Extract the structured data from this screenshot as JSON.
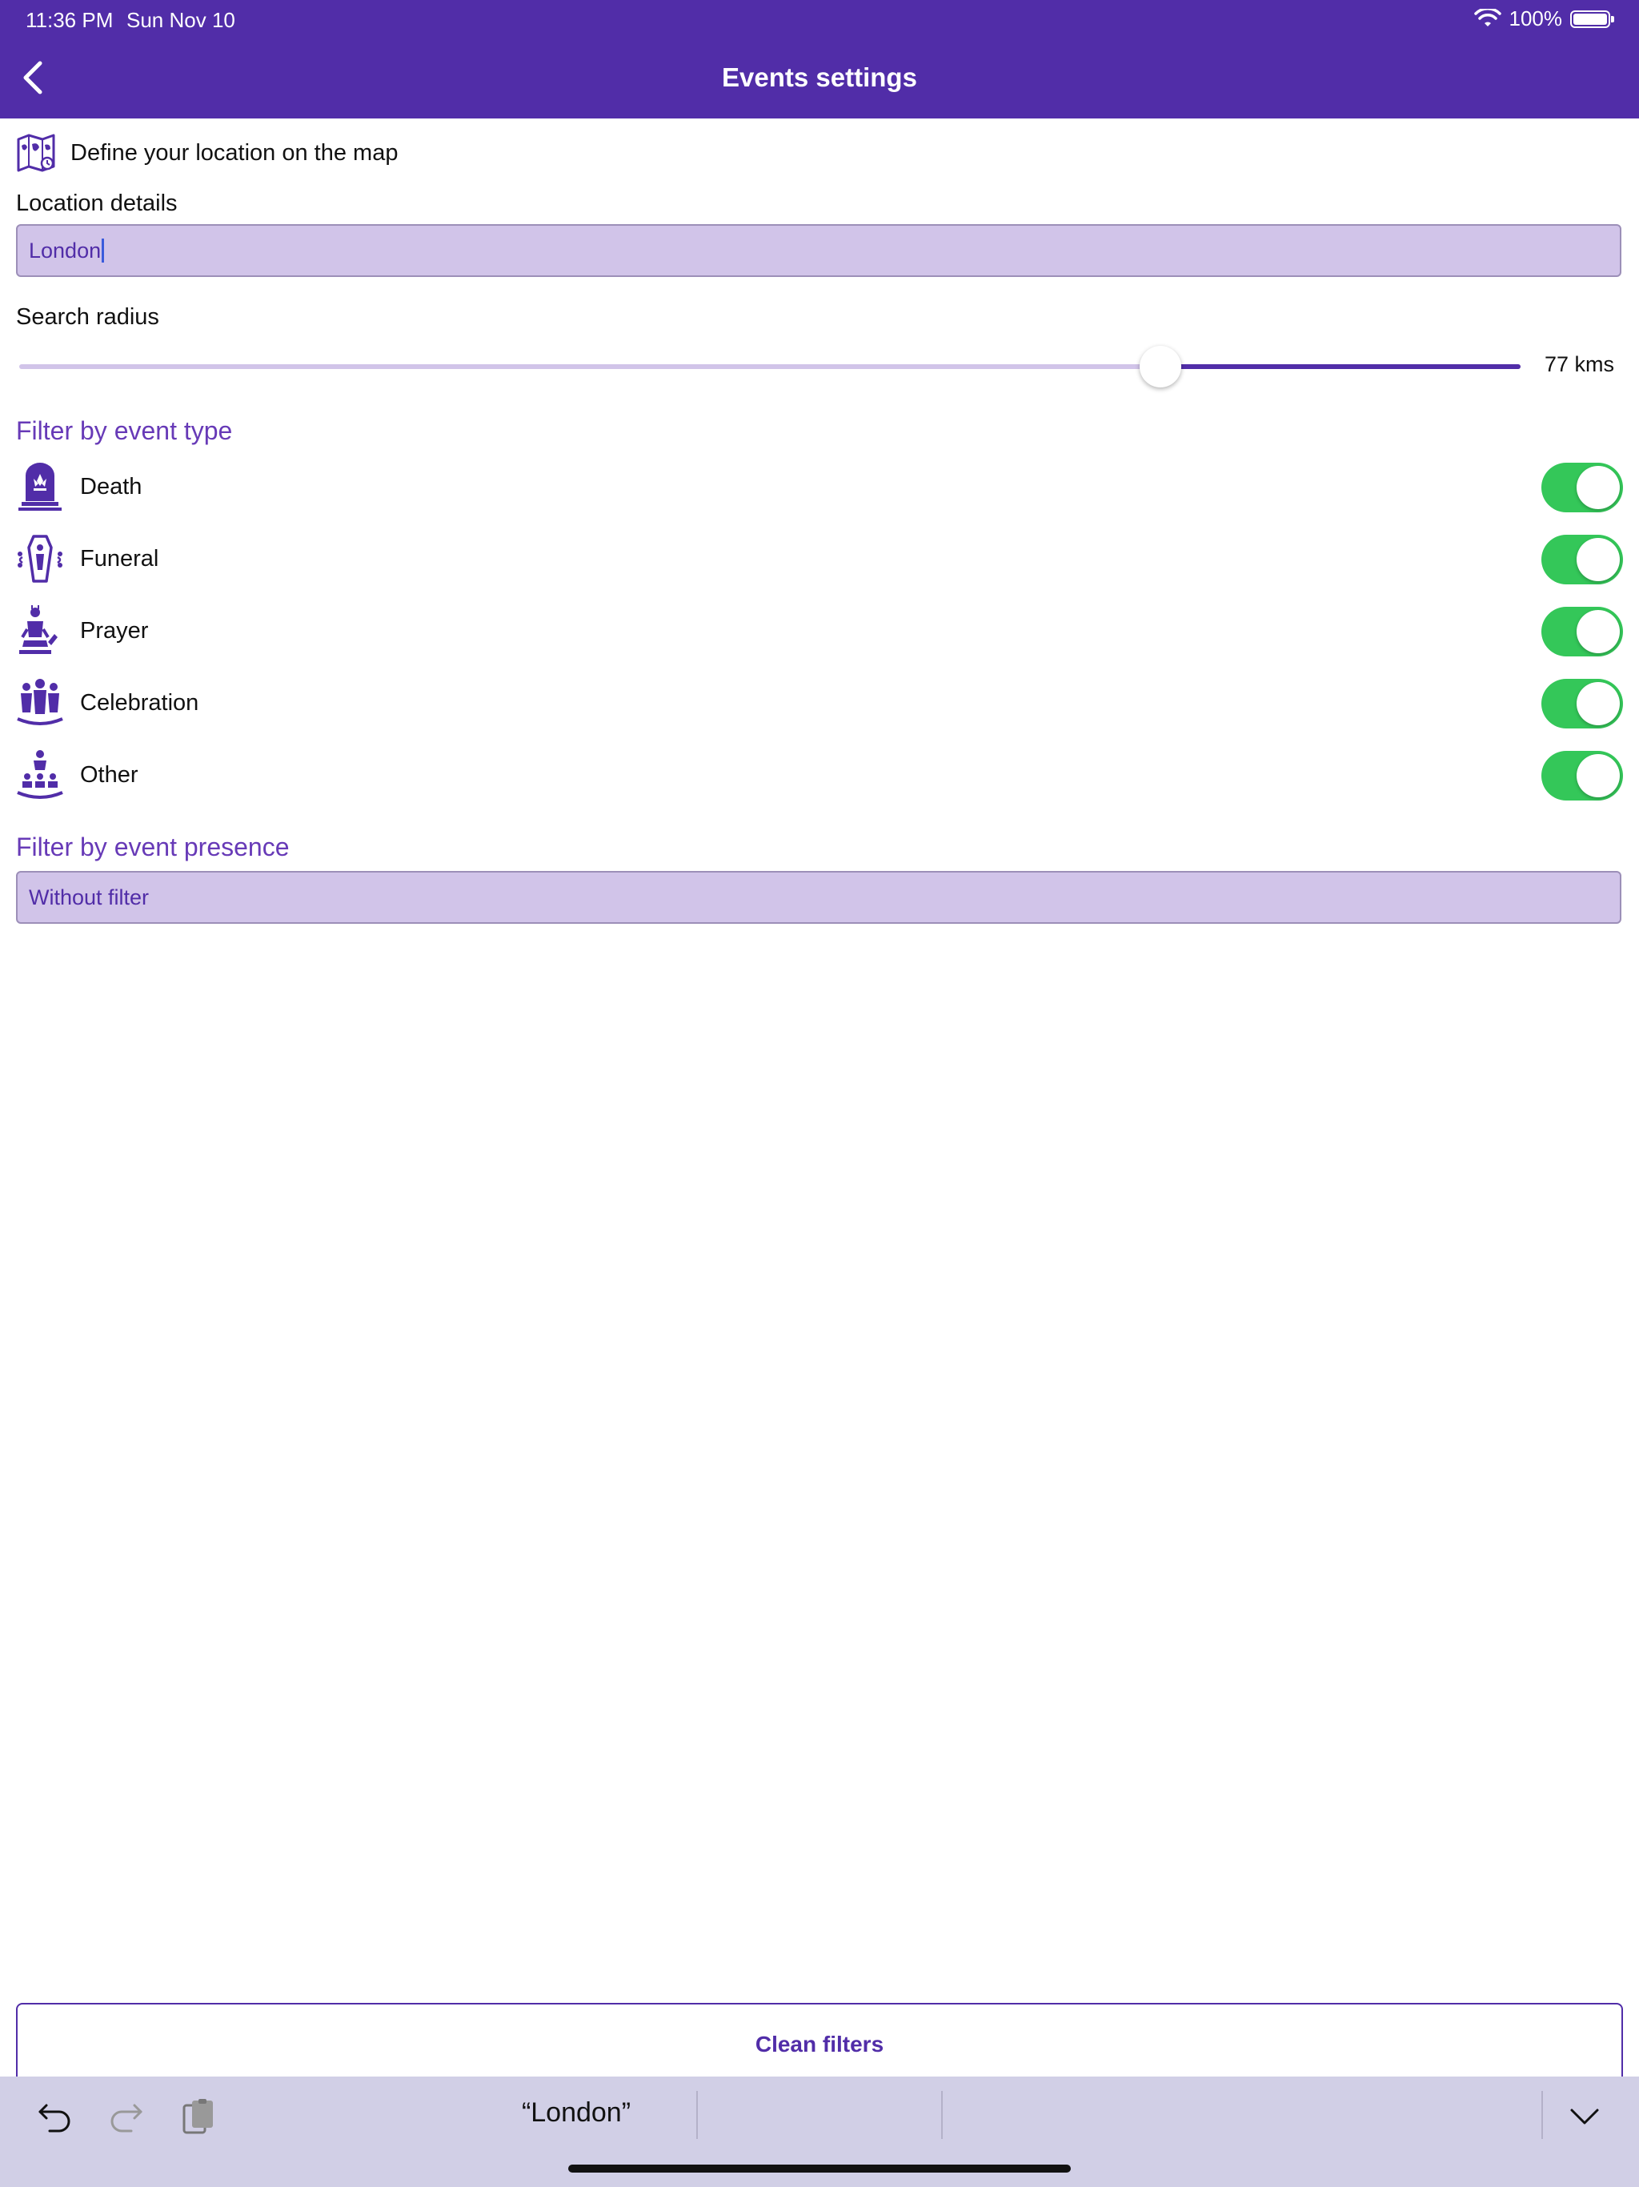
{
  "status_bar": {
    "time": "11:36 PM",
    "date": "Sun Nov 10",
    "battery": "100%"
  },
  "nav": {
    "title": "Events settings",
    "back_icon": "chevron-left-icon"
  },
  "location": {
    "map_link": "Define your location on the map",
    "details_label": "Location details",
    "value": "London"
  },
  "radius": {
    "label": "Search radius",
    "value_text": "77 kms",
    "fraction": 0.76
  },
  "event_type": {
    "title": "Filter by event type",
    "items": [
      {
        "label": "Death",
        "icon": "tombstone-icon",
        "enabled": true
      },
      {
        "label": "Funeral",
        "icon": "coffin-icon",
        "enabled": true
      },
      {
        "label": "Prayer",
        "icon": "prayer-icon",
        "enabled": true
      },
      {
        "label": "Celebration",
        "icon": "people-group-icon",
        "enabled": true
      },
      {
        "label": "Other",
        "icon": "gathering-icon",
        "enabled": true
      }
    ]
  },
  "presence": {
    "title": "Filter by event presence",
    "value": "Without filter"
  },
  "actions": {
    "clean_label": "Clean filters"
  },
  "keyboard": {
    "suggestion": "“London”"
  },
  "colors": {
    "primary": "#512DA8",
    "accent": "#673AB7",
    "field_bg": "#D1C4E9",
    "toggle_on": "#34C759"
  }
}
